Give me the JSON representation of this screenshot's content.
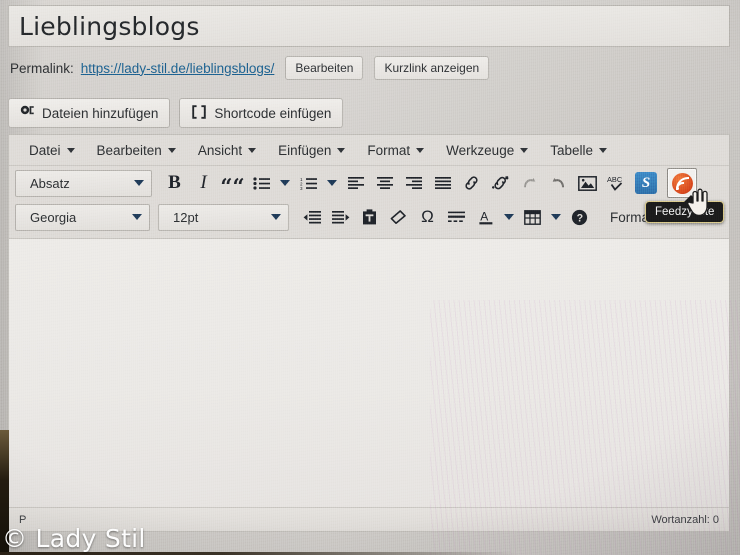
{
  "post": {
    "title": "Lieblingsblogs",
    "permalink_label": "Permalink:",
    "permalink_url": "https://lady-stil.de/lieblingsblogs/",
    "edit_button": "Bearbeiten",
    "shortlink_button": "Kurzlink anzeigen"
  },
  "media_buttons": [
    {
      "label": "Dateien hinzufügen",
      "icon": "media-camera-icon"
    },
    {
      "label": "Shortcode einfügen",
      "icon": "brackets-icon"
    }
  ],
  "menubar": [
    {
      "label": "Datei"
    },
    {
      "label": "Bearbeiten"
    },
    {
      "label": "Ansicht"
    },
    {
      "label": "Einfügen"
    },
    {
      "label": "Format"
    },
    {
      "label": "Werkzeuge"
    },
    {
      "label": "Tabelle"
    }
  ],
  "toolbar_row1": {
    "paragraph_style": "Absatz",
    "tools": [
      {
        "name": "bold",
        "glyph": "B"
      },
      {
        "name": "italic",
        "glyph": "I"
      },
      {
        "name": "blockquote",
        "glyph": "“"
      },
      {
        "name": "bullet-list"
      },
      {
        "name": "bullet-list-options"
      },
      {
        "name": "numbered-list"
      },
      {
        "name": "numbered-list-options"
      },
      {
        "name": "align-left"
      },
      {
        "name": "align-center"
      },
      {
        "name": "align-right"
      },
      {
        "name": "align-justify"
      },
      {
        "name": "insert-link"
      },
      {
        "name": "remove-link"
      },
      {
        "name": "undo"
      },
      {
        "name": "redo"
      },
      {
        "name": "insert-image"
      },
      {
        "name": "spellcheck",
        "glyph": "ABC"
      },
      {
        "name": "shortcode-s",
        "glyph": "S"
      },
      {
        "name": "feedzy-rss"
      }
    ]
  },
  "toolbar_row2": {
    "font_family": "Georgia",
    "font_size": "12pt",
    "formats_label": "Formate",
    "tools": [
      {
        "name": "decrease-indent"
      },
      {
        "name": "increase-indent"
      },
      {
        "name": "paste-as-text"
      },
      {
        "name": "clear-formatting"
      },
      {
        "name": "special-character",
        "glyph": "Ω"
      },
      {
        "name": "horizontal-rule"
      },
      {
        "name": "text-color",
        "glyph": "A"
      },
      {
        "name": "text-color-options"
      },
      {
        "name": "insert-table"
      },
      {
        "name": "insert-table-options"
      },
      {
        "name": "help",
        "glyph": "?"
      }
    ]
  },
  "tooltip": {
    "text": "Feedzy Lite"
  },
  "statusbar": {
    "path": "P",
    "word_count": "Wortanzahl: 0"
  },
  "watermark": {
    "text": "© Lady Stil"
  },
  "colors": {
    "link": "#1c5f8e",
    "rss_orange": "#d6461d",
    "shortcode_blue": "#3d88c6",
    "tooltip_bg": "#1b1b1b",
    "chrome": "#dedbd7"
  }
}
